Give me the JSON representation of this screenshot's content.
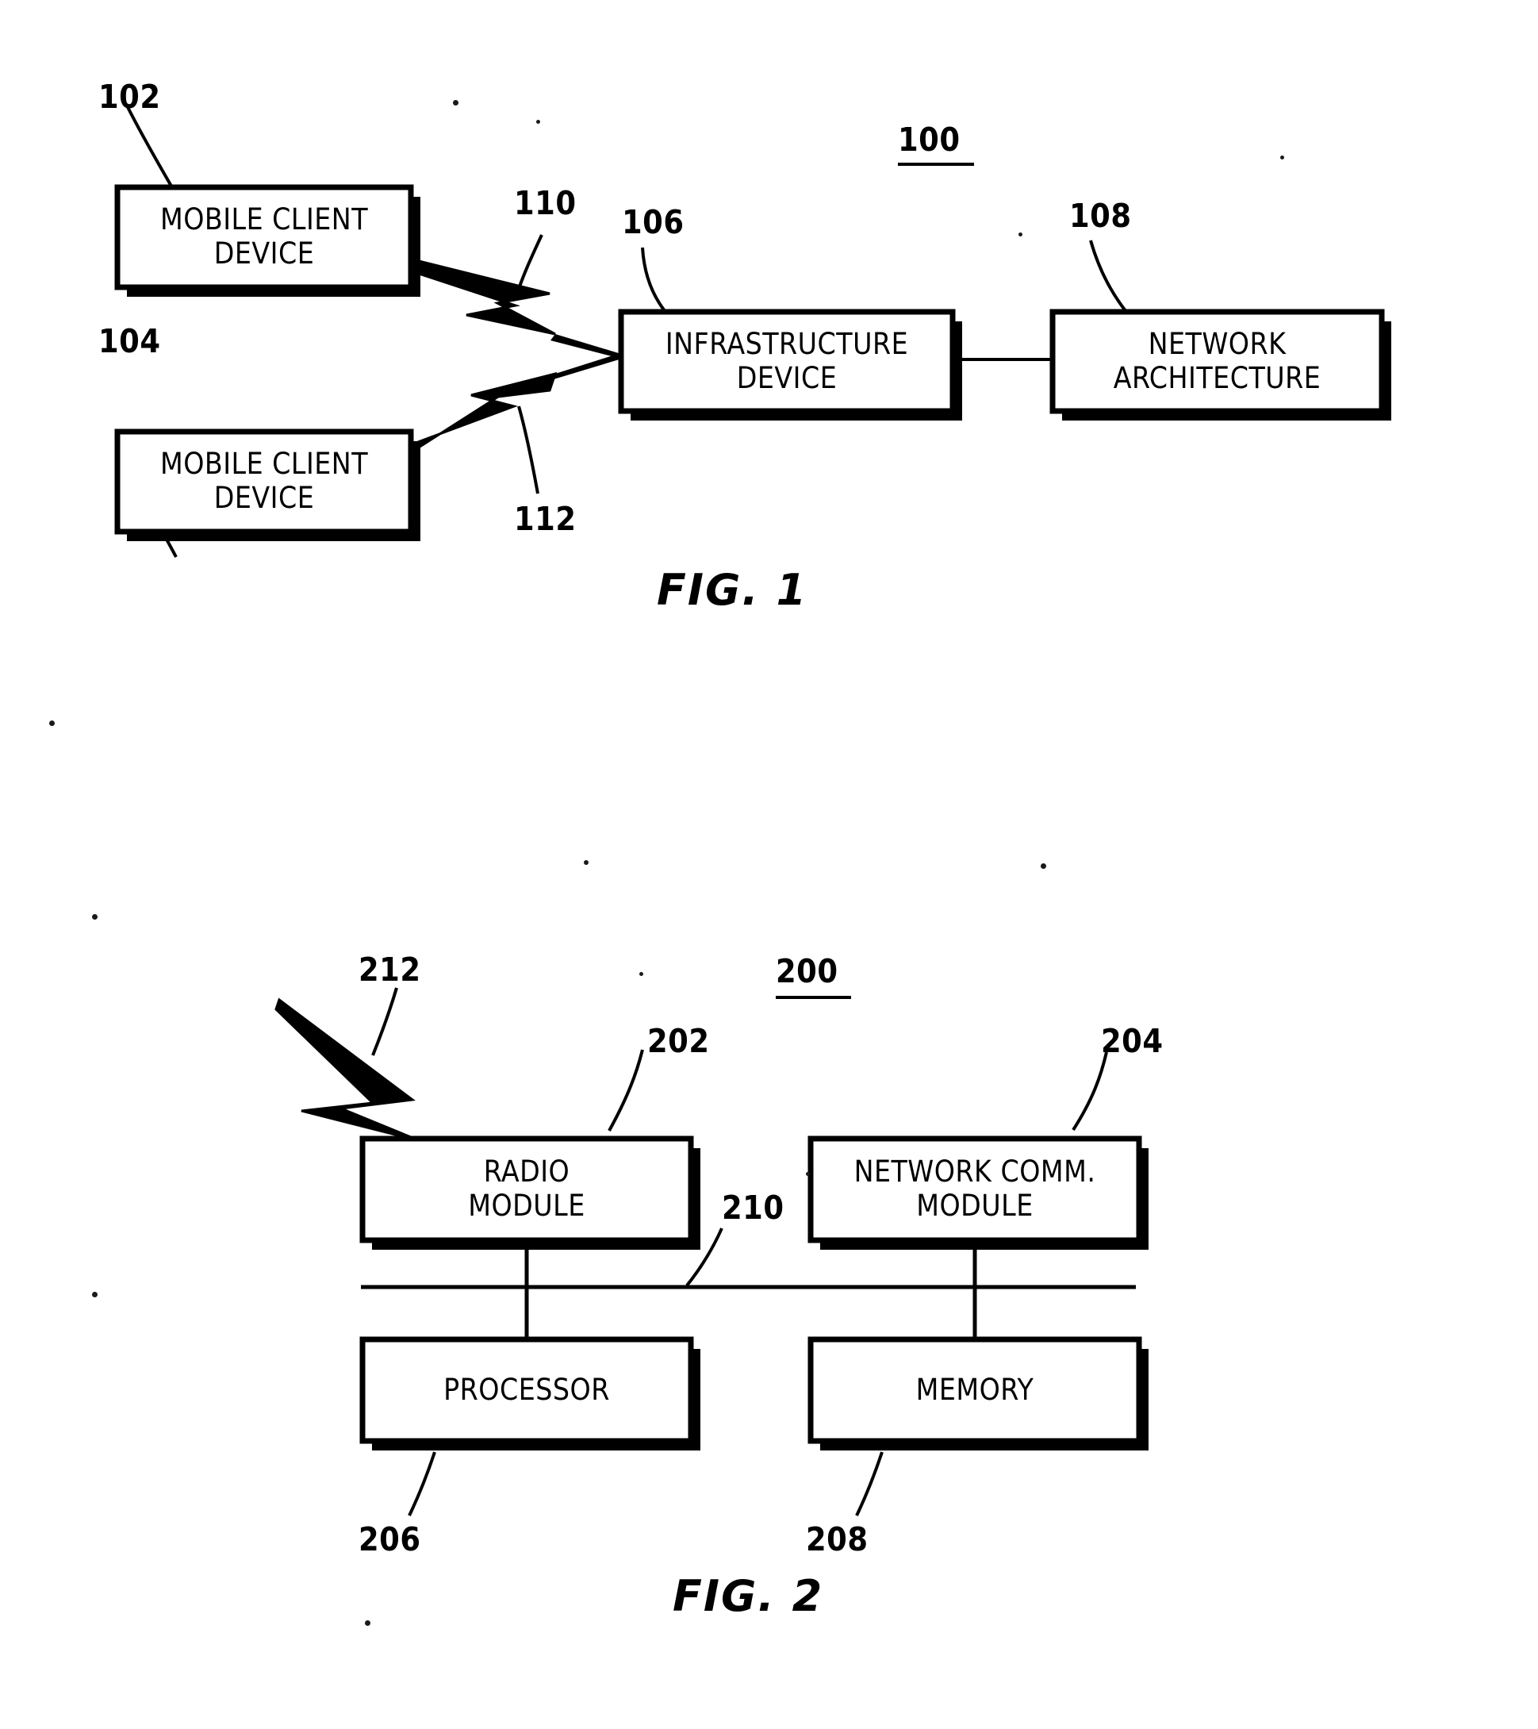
{
  "document": {
    "type": "patent-drawing-sheet",
    "ink_color": "#000000",
    "paper_color": "#ffffff"
  },
  "figures": [
    {
      "id": "fig1",
      "caption": "FIG. 1",
      "system_numeral": "100",
      "boxes": [
        {
          "id": "mobile-client-device-1",
          "numeral": "102",
          "lines": [
            "MOBILE CLIENT",
            "DEVICE"
          ]
        },
        {
          "id": "mobile-client-device-2",
          "numeral": "104",
          "lines": [
            "MOBILE CLIENT",
            "DEVICE"
          ]
        },
        {
          "id": "infrastructure-device",
          "numeral": "106",
          "lines": [
            "INFRASTRUCTURE",
            "DEVICE"
          ]
        },
        {
          "id": "network-architecture",
          "numeral": "108",
          "lines": [
            "NETWORK",
            "ARCHITECTURE"
          ]
        }
      ],
      "links": [
        {
          "id": "wireless-link-upper",
          "numeral": "110",
          "kind": "lightning-bolt"
        },
        {
          "id": "wireless-link-lower",
          "numeral": "112",
          "kind": "lightning-bolt"
        },
        {
          "id": "wired-link",
          "numeral": "",
          "kind": "plain-line"
        }
      ]
    },
    {
      "id": "fig2",
      "caption": "FIG. 2",
      "system_numeral": "200",
      "boxes": [
        {
          "id": "radio-module",
          "numeral": "202",
          "lines": [
            "RADIO",
            "MODULE"
          ]
        },
        {
          "id": "network-comm-module",
          "numeral": "204",
          "lines": [
            "NETWORK COMM.",
            "MODULE"
          ]
        },
        {
          "id": "processor",
          "numeral": "206",
          "lines": [
            "PROCESSOR"
          ]
        },
        {
          "id": "memory",
          "numeral": "208",
          "lines": [
            "MEMORY"
          ]
        }
      ],
      "links": [
        {
          "id": "bus",
          "numeral": "210",
          "kind": "plain-line"
        },
        {
          "id": "wireless-signal",
          "numeral": "212",
          "kind": "lightning-bolt"
        }
      ]
    }
  ]
}
